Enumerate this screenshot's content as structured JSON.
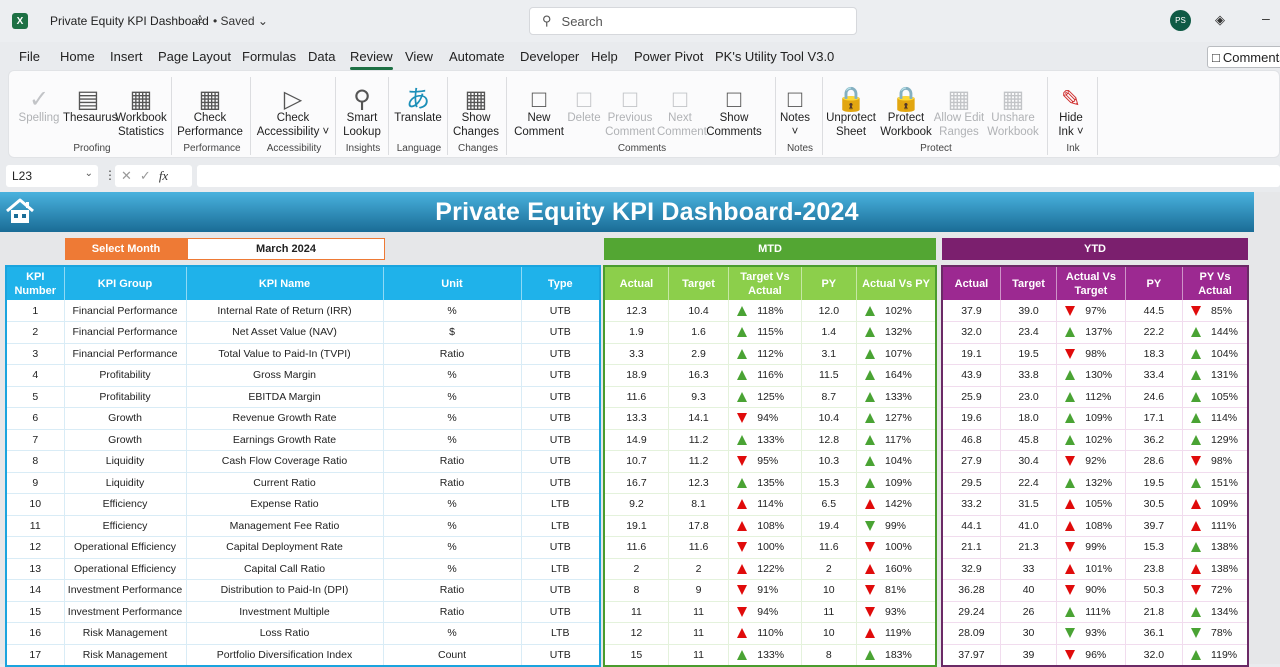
{
  "app": {
    "doc_title": "Private Equity KPI Dashboard",
    "saved_status": "• Saved",
    "search_placeholder": "Search",
    "user_initials": "PS",
    "comments_label": "Comments"
  },
  "menu": [
    "File",
    "Home",
    "Insert",
    "Page Layout",
    "Formulas",
    "Data",
    "Review",
    "View",
    "Automate",
    "Developer",
    "Help",
    "Power Pivot",
    "PK's Utility Tool V3.0"
  ],
  "active_menu": "Review",
  "ribbon": {
    "buttons": [
      {
        "label": "Spelling",
        "disabled": true
      },
      {
        "label": "Thesaurus"
      },
      {
        "label": "Workbook Statistics"
      },
      {
        "label": "Check Performance"
      },
      {
        "label": "Check Accessibility ˅"
      },
      {
        "label": "Smart Lookup"
      },
      {
        "label": "Translate"
      },
      {
        "label": "Show Changes"
      },
      {
        "label": "New Comment"
      },
      {
        "label": "Delete",
        "disabled": true
      },
      {
        "label": "Previous Comment",
        "disabled": true
      },
      {
        "label": "Next Comment",
        "disabled": true
      },
      {
        "label": "Show Comments"
      },
      {
        "label": "Notes ˅"
      },
      {
        "label": "Unprotect Sheet"
      },
      {
        "label": "Protect Workbook"
      },
      {
        "label": "Allow Edit Ranges",
        "disabled": true
      },
      {
        "label": "Unshare Workbook",
        "disabled": true
      },
      {
        "label": "Hide Ink ˅"
      }
    ],
    "groups": [
      "Proofing",
      "Performance",
      "Accessibility",
      "Insights",
      "Language",
      "Changes",
      "Comments",
      "Notes",
      "Protect",
      "Ink"
    ]
  },
  "formula_bar": {
    "name_box": "L23",
    "formula": ""
  },
  "dashboard": {
    "title": "Private Equity KPI Dashboard-2024",
    "select_month_label": "Select Month",
    "selected_month": "March 2024",
    "mtd_label": "MTD",
    "ytd_label": "YTD",
    "info_headers": [
      "KPI Number",
      "KPI Group",
      "KPI Name",
      "Unit",
      "Type"
    ],
    "mtd_headers": [
      "Actual",
      "Target",
      "Target Vs Actual",
      "PY",
      "Actual Vs PY"
    ],
    "ytd_headers": [
      "Actual",
      "Target",
      "Actual Vs Target",
      "PY",
      "PY Vs Actual"
    ],
    "rows": [
      {
        "num": "1",
        "group": "Financial Performance",
        "name": "Internal Rate of Return (IRR)",
        "unit": "%",
        "type": "UTB",
        "mtd": {
          "actual": "12.3",
          "target": "10.4",
          "tva": "118%",
          "tva_dir": "up",
          "tva_color": "green",
          "py": "12.0",
          "avp": "102%",
          "avp_dir": "up",
          "avp_color": "green"
        },
        "ytd": {
          "actual": "37.9",
          "target": "39.0",
          "avt": "97%",
          "avt_dir": "down",
          "avt_color": "red",
          "py": "44.5",
          "pva": "85%",
          "pva_dir": "down",
          "pva_color": "red"
        }
      },
      {
        "num": "2",
        "group": "Financial Performance",
        "name": "Net Asset Value (NAV)",
        "unit": "$",
        "type": "UTB",
        "mtd": {
          "actual": "1.9",
          "target": "1.6",
          "tva": "115%",
          "tva_dir": "up",
          "tva_color": "green",
          "py": "1.4",
          "avp": "132%",
          "avp_dir": "up",
          "avp_color": "green"
        },
        "ytd": {
          "actual": "32.0",
          "target": "23.4",
          "avt": "137%",
          "avt_dir": "up",
          "avt_color": "green",
          "py": "22.2",
          "pva": "144%",
          "pva_dir": "up",
          "pva_color": "green"
        }
      },
      {
        "num": "3",
        "group": "Financial Performance",
        "name": "Total Value to Paid-In (TVPI)",
        "unit": "Ratio",
        "type": "UTB",
        "mtd": {
          "actual": "3.3",
          "target": "2.9",
          "tva": "112%",
          "tva_dir": "up",
          "tva_color": "green",
          "py": "3.1",
          "avp": "107%",
          "avp_dir": "up",
          "avp_color": "green"
        },
        "ytd": {
          "actual": "19.1",
          "target": "19.5",
          "avt": "98%",
          "avt_dir": "down",
          "avt_color": "red",
          "py": "18.3",
          "pva": "104%",
          "pva_dir": "up",
          "pva_color": "green"
        }
      },
      {
        "num": "4",
        "group": "Profitability",
        "name": "Gross Margin",
        "unit": "%",
        "type": "UTB",
        "mtd": {
          "actual": "18.9",
          "target": "16.3",
          "tva": "116%",
          "tva_dir": "up",
          "tva_color": "green",
          "py": "11.5",
          "avp": "164%",
          "avp_dir": "up",
          "avp_color": "green"
        },
        "ytd": {
          "actual": "43.9",
          "target": "33.8",
          "avt": "130%",
          "avt_dir": "up",
          "avt_color": "green",
          "py": "33.4",
          "pva": "131%",
          "pva_dir": "up",
          "pva_color": "green"
        }
      },
      {
        "num": "5",
        "group": "Profitability",
        "name": "EBITDA Margin",
        "unit": "%",
        "type": "UTB",
        "mtd": {
          "actual": "11.6",
          "target": "9.3",
          "tva": "125%",
          "tva_dir": "up",
          "tva_color": "green",
          "py": "8.7",
          "avp": "133%",
          "avp_dir": "up",
          "avp_color": "green"
        },
        "ytd": {
          "actual": "25.9",
          "target": "23.0",
          "avt": "112%",
          "avt_dir": "up",
          "avt_color": "green",
          "py": "24.6",
          "pva": "105%",
          "pva_dir": "up",
          "pva_color": "green"
        }
      },
      {
        "num": "6",
        "group": "Growth",
        "name": "Revenue Growth Rate",
        "unit": "%",
        "type": "UTB",
        "mtd": {
          "actual": "13.3",
          "target": "14.1",
          "tva": "94%",
          "tva_dir": "down",
          "tva_color": "red",
          "py": "10.4",
          "avp": "127%",
          "avp_dir": "up",
          "avp_color": "green"
        },
        "ytd": {
          "actual": "19.6",
          "target": "18.0",
          "avt": "109%",
          "avt_dir": "up",
          "avt_color": "green",
          "py": "17.1",
          "pva": "114%",
          "pva_dir": "up",
          "pva_color": "green"
        }
      },
      {
        "num": "7",
        "group": "Growth",
        "name": "Earnings Growth Rate",
        "unit": "%",
        "type": "UTB",
        "mtd": {
          "actual": "14.9",
          "target": "11.2",
          "tva": "133%",
          "tva_dir": "up",
          "tva_color": "green",
          "py": "12.8",
          "avp": "117%",
          "avp_dir": "up",
          "avp_color": "green"
        },
        "ytd": {
          "actual": "46.8",
          "target": "45.8",
          "avt": "102%",
          "avt_dir": "up",
          "avt_color": "green",
          "py": "36.2",
          "pva": "129%",
          "pva_dir": "up",
          "pva_color": "green"
        }
      },
      {
        "num": "8",
        "group": "Liquidity",
        "name": "Cash Flow Coverage Ratio",
        "unit": "Ratio",
        "type": "UTB",
        "mtd": {
          "actual": "10.7",
          "target": "11.2",
          "tva": "95%",
          "tva_dir": "down",
          "tva_color": "red",
          "py": "10.3",
          "avp": "104%",
          "avp_dir": "up",
          "avp_color": "green"
        },
        "ytd": {
          "actual": "27.9",
          "target": "30.4",
          "avt": "92%",
          "avt_dir": "down",
          "avt_color": "red",
          "py": "28.6",
          "pva": "98%",
          "pva_dir": "down",
          "pva_color": "red"
        }
      },
      {
        "num": "9",
        "group": "Liquidity",
        "name": "Current Ratio",
        "unit": "Ratio",
        "type": "UTB",
        "mtd": {
          "actual": "16.7",
          "target": "12.3",
          "tva": "135%",
          "tva_dir": "up",
          "tva_color": "green",
          "py": "15.3",
          "avp": "109%",
          "avp_dir": "up",
          "avp_color": "green"
        },
        "ytd": {
          "actual": "29.5",
          "target": "22.4",
          "avt": "132%",
          "avt_dir": "up",
          "avt_color": "green",
          "py": "19.5",
          "pva": "151%",
          "pva_dir": "up",
          "pva_color": "green"
        }
      },
      {
        "num": "10",
        "group": "Efficiency",
        "name": "Expense Ratio",
        "unit": "%",
        "type": "LTB",
        "mtd": {
          "actual": "9.2",
          "target": "8.1",
          "tva": "114%",
          "tva_dir": "up",
          "tva_color": "red",
          "py": "6.5",
          "avp": "142%",
          "avp_dir": "up",
          "avp_color": "red"
        },
        "ytd": {
          "actual": "33.2",
          "target": "31.5",
          "avt": "105%",
          "avt_dir": "up",
          "avt_color": "red",
          "py": "30.5",
          "pva": "109%",
          "pva_dir": "up",
          "pva_color": "red"
        }
      },
      {
        "num": "11",
        "group": "Efficiency",
        "name": "Management Fee Ratio",
        "unit": "%",
        "type": "LTB",
        "mtd": {
          "actual": "19.1",
          "target": "17.8",
          "tva": "108%",
          "tva_dir": "up",
          "tva_color": "red",
          "py": "19.4",
          "avp": "99%",
          "avp_dir": "down",
          "avp_color": "green"
        },
        "ytd": {
          "actual": "44.1",
          "target": "41.0",
          "avt": "108%",
          "avt_dir": "up",
          "avt_color": "red",
          "py": "39.7",
          "pva": "111%",
          "pva_dir": "up",
          "pva_color": "red"
        }
      },
      {
        "num": "12",
        "group": "Operational Efficiency",
        "name": "Capital Deployment Rate",
        "unit": "%",
        "type": "UTB",
        "mtd": {
          "actual": "11.6",
          "target": "11.6",
          "tva": "100%",
          "tva_dir": "down",
          "tva_color": "red",
          "py": "11.6",
          "avp": "100%",
          "avp_dir": "down",
          "avp_color": "red"
        },
        "ytd": {
          "actual": "21.1",
          "target": "21.3",
          "avt": "99%",
          "avt_dir": "down",
          "avt_color": "red",
          "py": "15.3",
          "pva": "138%",
          "pva_dir": "up",
          "pva_color": "green"
        }
      },
      {
        "num": "13",
        "group": "Operational Efficiency",
        "name": "Capital Call Ratio",
        "unit": "%",
        "type": "LTB",
        "mtd": {
          "actual": "2",
          "target": "2",
          "tva": "122%",
          "tva_dir": "up",
          "tva_color": "red",
          "py": "2",
          "avp": "160%",
          "avp_dir": "up",
          "avp_color": "red"
        },
        "ytd": {
          "actual": "32.9",
          "target": "33",
          "avt": "101%",
          "avt_dir": "up",
          "avt_color": "red",
          "py": "23.8",
          "pva": "138%",
          "pva_dir": "up",
          "pva_color": "red"
        }
      },
      {
        "num": "14",
        "group": "Investment Performance",
        "name": "Distribution to Paid-In (DPI)",
        "unit": "Ratio",
        "type": "UTB",
        "mtd": {
          "actual": "8",
          "target": "9",
          "tva": "91%",
          "tva_dir": "down",
          "tva_color": "red",
          "py": "10",
          "avp": "81%",
          "avp_dir": "down",
          "avp_color": "red"
        },
        "ytd": {
          "actual": "36.28",
          "target": "40",
          "avt": "90%",
          "avt_dir": "down",
          "avt_color": "red",
          "py": "50.3",
          "pva": "72%",
          "pva_dir": "down",
          "pva_color": "red"
        }
      },
      {
        "num": "15",
        "group": "Investment Performance",
        "name": "Investment Multiple",
        "unit": "Ratio",
        "type": "UTB",
        "mtd": {
          "actual": "11",
          "target": "11",
          "tva": "94%",
          "tva_dir": "down",
          "tva_color": "red",
          "py": "11",
          "avp": "93%",
          "avp_dir": "down",
          "avp_color": "red"
        },
        "ytd": {
          "actual": "29.24",
          "target": "26",
          "avt": "111%",
          "avt_dir": "up",
          "avt_color": "green",
          "py": "21.8",
          "pva": "134%",
          "pva_dir": "up",
          "pva_color": "green"
        }
      },
      {
        "num": "16",
        "group": "Risk Management",
        "name": "Loss Ratio",
        "unit": "%",
        "type": "LTB",
        "mtd": {
          "actual": "12",
          "target": "11",
          "tva": "110%",
          "tva_dir": "up",
          "tva_color": "red",
          "py": "10",
          "avp": "119%",
          "avp_dir": "up",
          "avp_color": "red"
        },
        "ytd": {
          "actual": "28.09",
          "target": "30",
          "avt": "93%",
          "avt_dir": "down",
          "avt_color": "green",
          "py": "36.1",
          "pva": "78%",
          "pva_dir": "down",
          "pva_color": "green"
        }
      },
      {
        "num": "17",
        "group": "Risk Management",
        "name": "Portfolio Diversification Index",
        "unit": "Count",
        "type": "UTB",
        "mtd": {
          "actual": "15",
          "target": "11",
          "tva": "133%",
          "tva_dir": "up",
          "tva_color": "green",
          "py": "8",
          "avp": "183%",
          "avp_dir": "up",
          "avp_color": "green"
        },
        "ytd": {
          "actual": "37.97",
          "target": "39",
          "avt": "96%",
          "avt_dir": "down",
          "avt_color": "red",
          "py": "32.0",
          "pva": "119%",
          "pva_dir": "up",
          "pva_color": "green"
        }
      }
    ]
  },
  "colors": {
    "banner": "#1a6c96",
    "select_month": "#ee7a35",
    "mtd": "#53a633",
    "ytd": "#7b1f6e",
    "info_header": "#1fb2ea",
    "good": "#4aa334",
    "bad": "#e00b0b"
  }
}
